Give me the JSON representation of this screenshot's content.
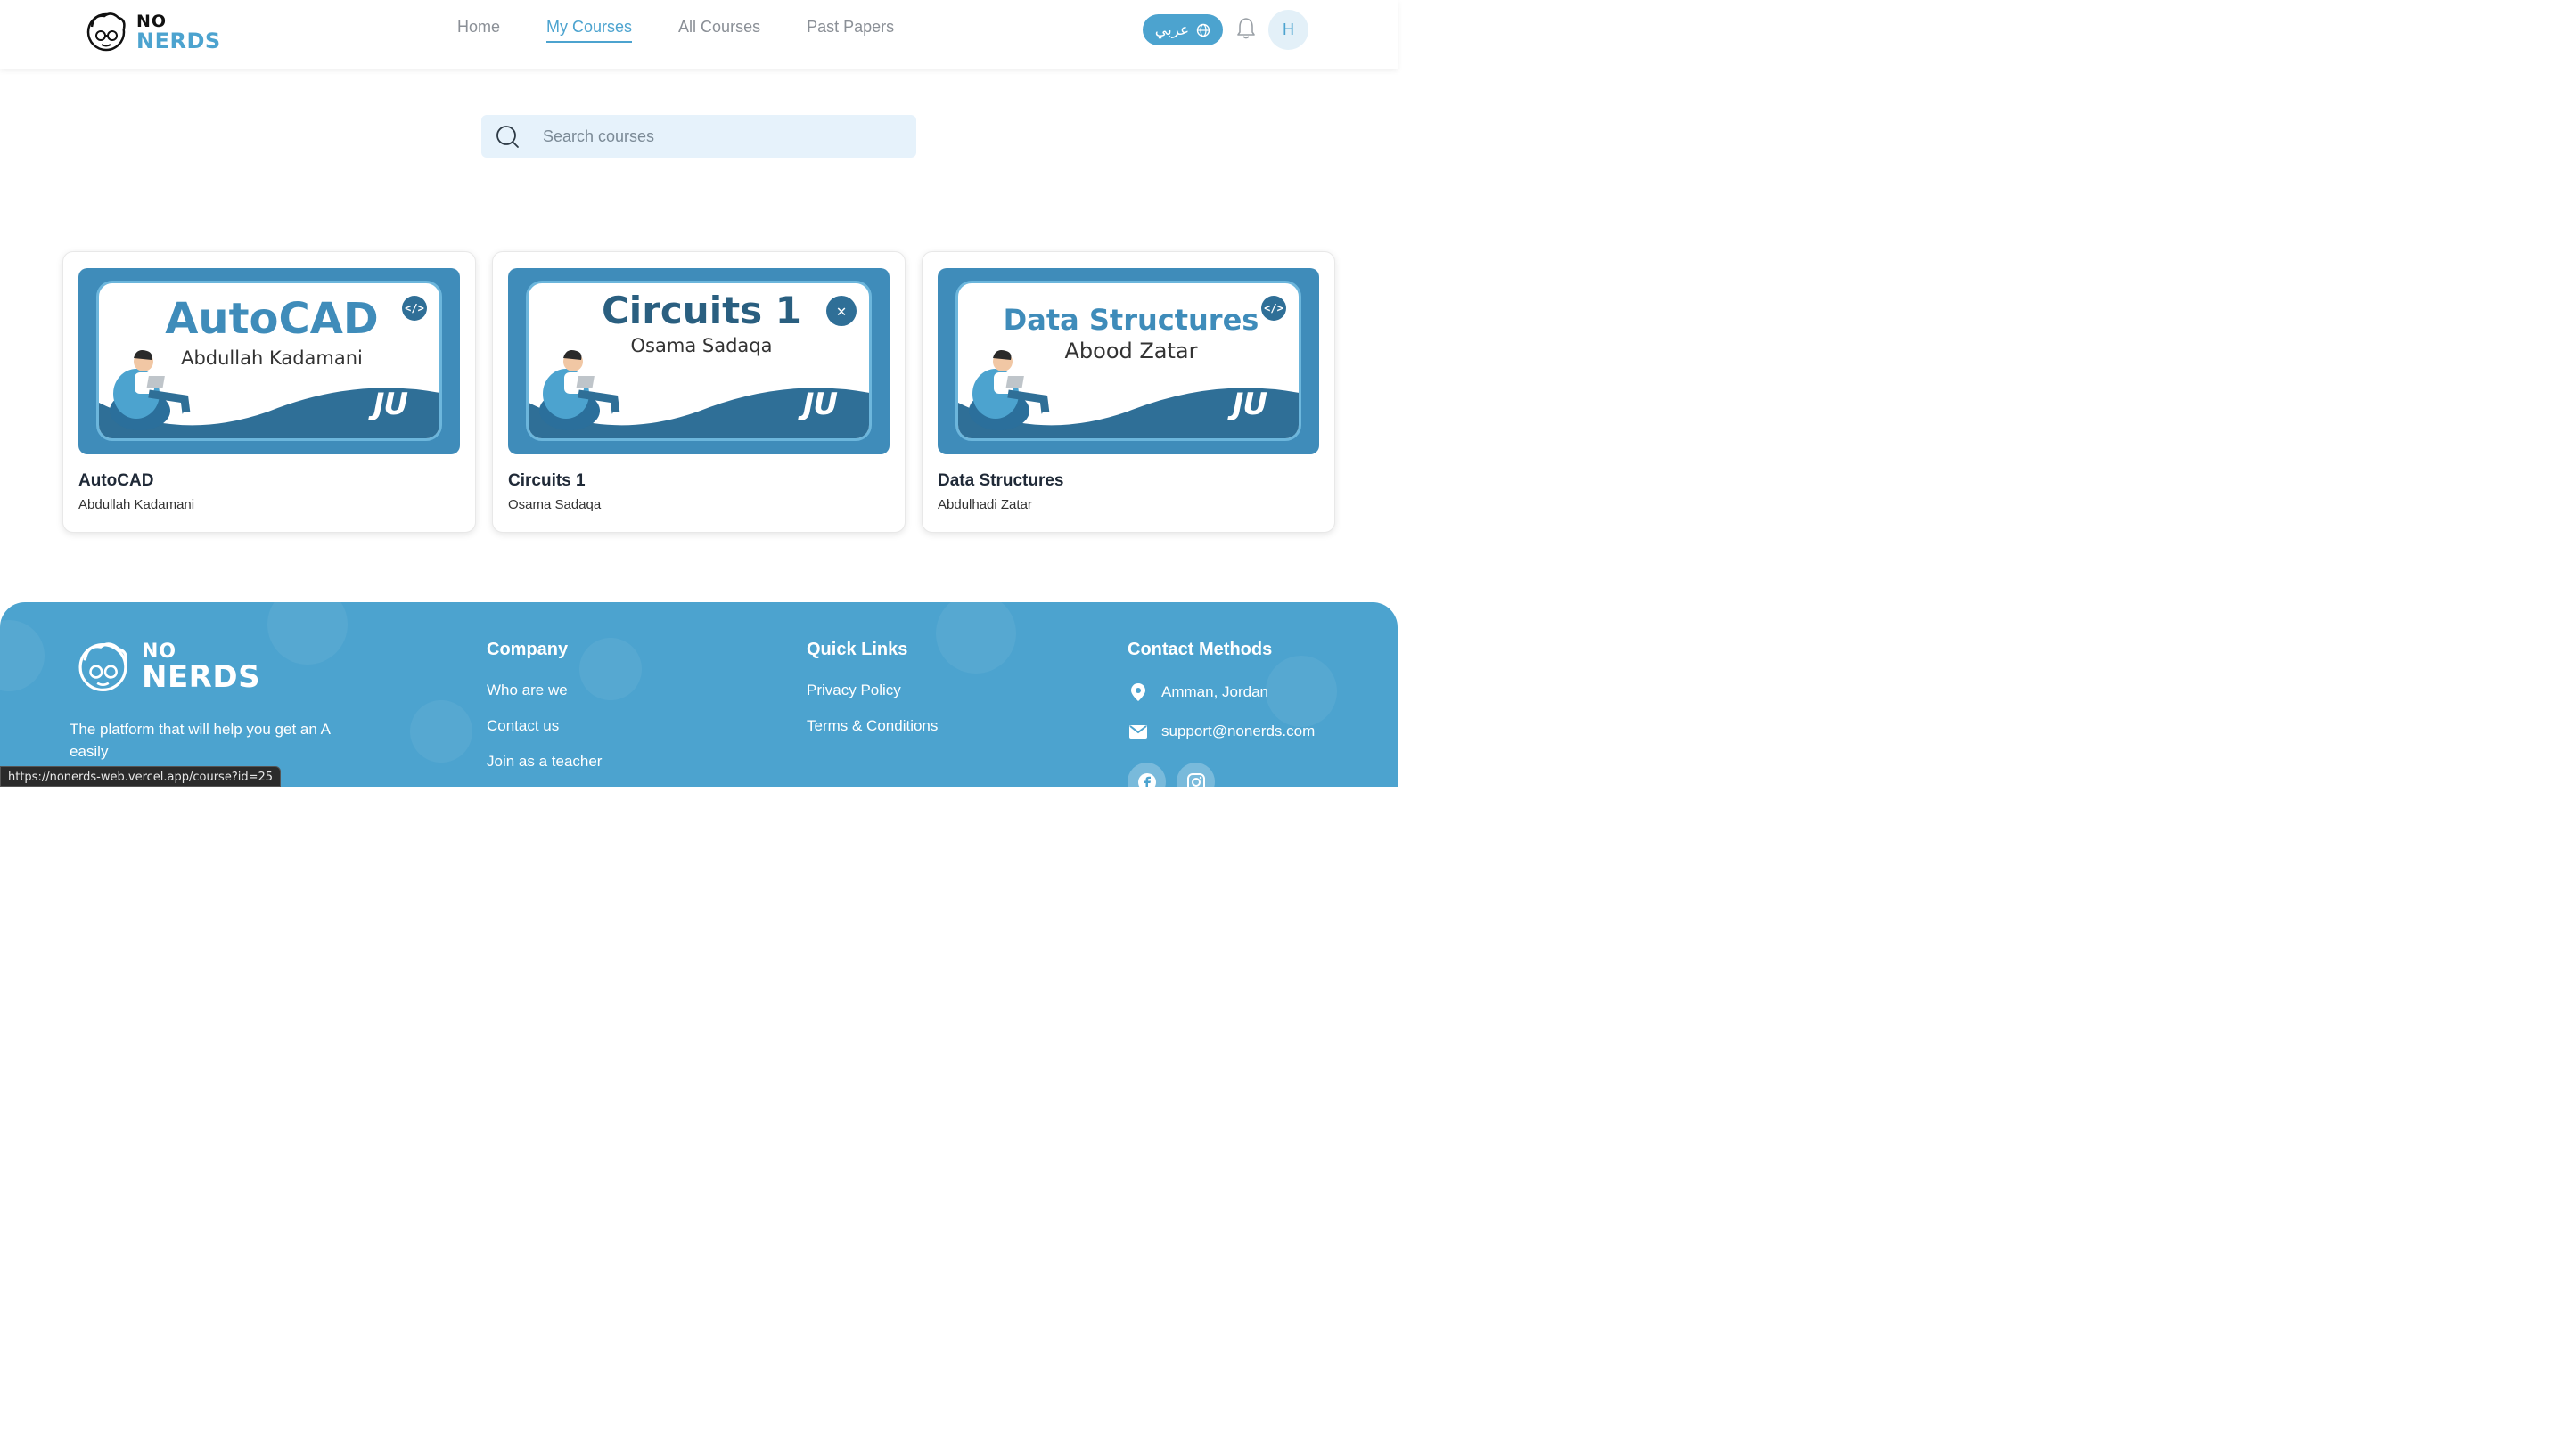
{
  "header": {
    "logo": {
      "top": "NO",
      "bottom": "NERDS"
    },
    "nav": [
      {
        "label": "Home",
        "active": false
      },
      {
        "label": "My Courses",
        "active": true
      },
      {
        "label": "All Courses",
        "active": false
      },
      {
        "label": "Past Papers",
        "active": false
      }
    ],
    "language_button": "عربي",
    "avatar_initial": "H"
  },
  "search": {
    "placeholder": "Search courses",
    "value": ""
  },
  "courses": [
    {
      "title": "AutoCAD",
      "teacher": "Abdullah Kadamani",
      "thumb_title": "AutoCAD",
      "thumb_subtitle": "Abdullah Kadamani",
      "thumb_badge": "</>",
      "thumb_logo": "JU"
    },
    {
      "title": "Circuits 1",
      "teacher": "Osama Sadaqa",
      "thumb_title": "Circuits 1",
      "thumb_subtitle": "Osama Sadaqa",
      "thumb_badge": "✕",
      "thumb_logo": "JU"
    },
    {
      "title": "Data Structures",
      "teacher": "Abdulhadi Zatar",
      "thumb_title": "Data Structures",
      "thumb_subtitle": "Abood Zatar",
      "thumb_badge": "</>",
      "thumb_logo": "JU"
    }
  ],
  "footer": {
    "logo": {
      "top": "NO",
      "bottom": "NERDS"
    },
    "tagline": "The platform that will help you get an A easily",
    "company": {
      "heading": "Company",
      "links": [
        "Who are we",
        "Contact us",
        "Join as a teacher"
      ]
    },
    "quick_links": {
      "heading": "Quick Links",
      "links": [
        "Privacy Policy",
        "Terms & Conditions"
      ]
    },
    "contact": {
      "heading": "Contact Methods",
      "location": "Amman, Jordan",
      "email": "support@nonerds.com"
    }
  },
  "status_bar_url": "https://nonerds-web.vercel.app/course?id=25",
  "colors": {
    "brand": "#4ca3cf",
    "thumb_bg": "#3f8cba"
  }
}
